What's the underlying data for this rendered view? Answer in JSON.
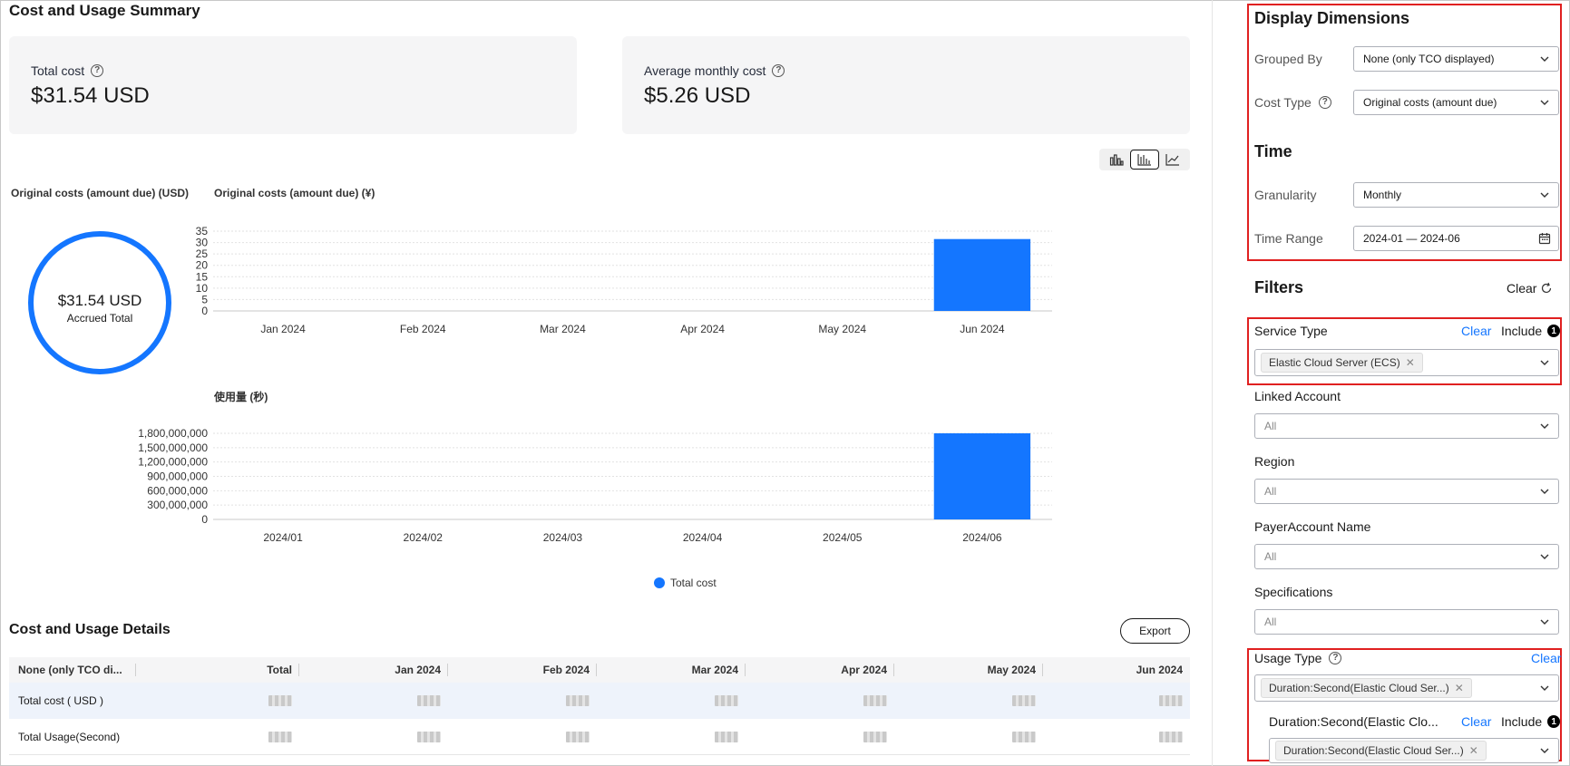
{
  "summary": {
    "title": "Cost and Usage Summary",
    "total_cost_label": "Total cost",
    "total_cost_value": "$31.54 USD",
    "avg_monthly_label": "Average monthly cost",
    "avg_monthly_value": "$5.26 USD"
  },
  "ring": {
    "title": "Original costs (amount due) (USD)",
    "value": "$31.54 USD",
    "subtitle": "Accrued Total",
    "color": "#1476ff"
  },
  "chart_switch": [
    "bar-chart-icon",
    "stacked-bar-chart-icon",
    "line-chart-icon"
  ],
  "chart_data": [
    {
      "type": "bar",
      "title": "Original costs (amount due) (¥)",
      "categories": [
        "Jan 2024",
        "Feb 2024",
        "Mar 2024",
        "Apr 2024",
        "May 2024",
        "Jun 2024"
      ],
      "values": [
        0,
        0,
        0,
        0,
        0,
        31.54
      ],
      "yticks": [
        "35",
        "30",
        "25",
        "20",
        "15",
        "10",
        "5",
        "0"
      ],
      "ylim": [
        0,
        35
      ],
      "color": "#1476ff"
    },
    {
      "type": "bar",
      "title": "使用量 (秒)",
      "categories": [
        "2024/01",
        "2024/02",
        "2024/03",
        "2024/04",
        "2024/05",
        "2024/06"
      ],
      "values": [
        0,
        0,
        0,
        0,
        0,
        1800000000
      ],
      "yticks": [
        "1,800,000,000",
        "1,500,000,000",
        "1,200,000,000",
        "900,000,000",
        "600,000,000",
        "300,000,000",
        "0"
      ],
      "ylim": [
        0,
        1800000000
      ],
      "color": "#1476ff"
    }
  ],
  "legend": {
    "label": "Total cost"
  },
  "details": {
    "title": "Cost and Usage Details",
    "export_label": "Export",
    "columns": [
      "None (only TCO di...",
      "Total",
      "Jan 2024",
      "Feb 2024",
      "Mar 2024",
      "Apr 2024",
      "May 2024",
      "Jun 2024"
    ],
    "rows": [
      {
        "label": "Total cost ( USD )"
      },
      {
        "label": "Total Usage(Second)"
      }
    ]
  },
  "panel": {
    "display_title": "Display Dimensions",
    "grouped_by_label": "Grouped By",
    "grouped_by_value": "None (only TCO displayed)",
    "cost_type_label": "Cost Type",
    "cost_type_value": "Original costs (amount due)",
    "time_title": "Time",
    "granularity_label": "Granularity",
    "granularity_value": "Monthly",
    "time_range_label": "Time Range",
    "time_range_value": "2024-01 — 2024-06",
    "filters_title": "Filters",
    "filters_clear": "Clear",
    "service_type_label": "Service Type",
    "service_type_clear": "Clear",
    "service_type_include": "Include",
    "service_type_badge": "1",
    "service_type_tag": "Elastic Cloud Server (ECS)",
    "linked_account_label": "Linked Account",
    "linked_account_value": "All",
    "region_label": "Region",
    "region_value": "All",
    "payer_label": "PayerAccount Name",
    "payer_value": "All",
    "spec_label": "Specifications",
    "spec_value": "All",
    "usage_type_label": "Usage Type",
    "usage_type_clear": "Clear",
    "usage_type_tag": "Duration:Second(Elastic Cloud Ser...)",
    "usage_sub_label": "Duration:Second(Elastic Clo...",
    "usage_sub_clear": "Clear",
    "usage_sub_include": "Include",
    "usage_sub_badge": "1",
    "usage_sub_tag": "Duration:Second(Elastic Cloud Ser...)",
    "highlight_color": "#e02020",
    "link_color": "#1476ff"
  }
}
